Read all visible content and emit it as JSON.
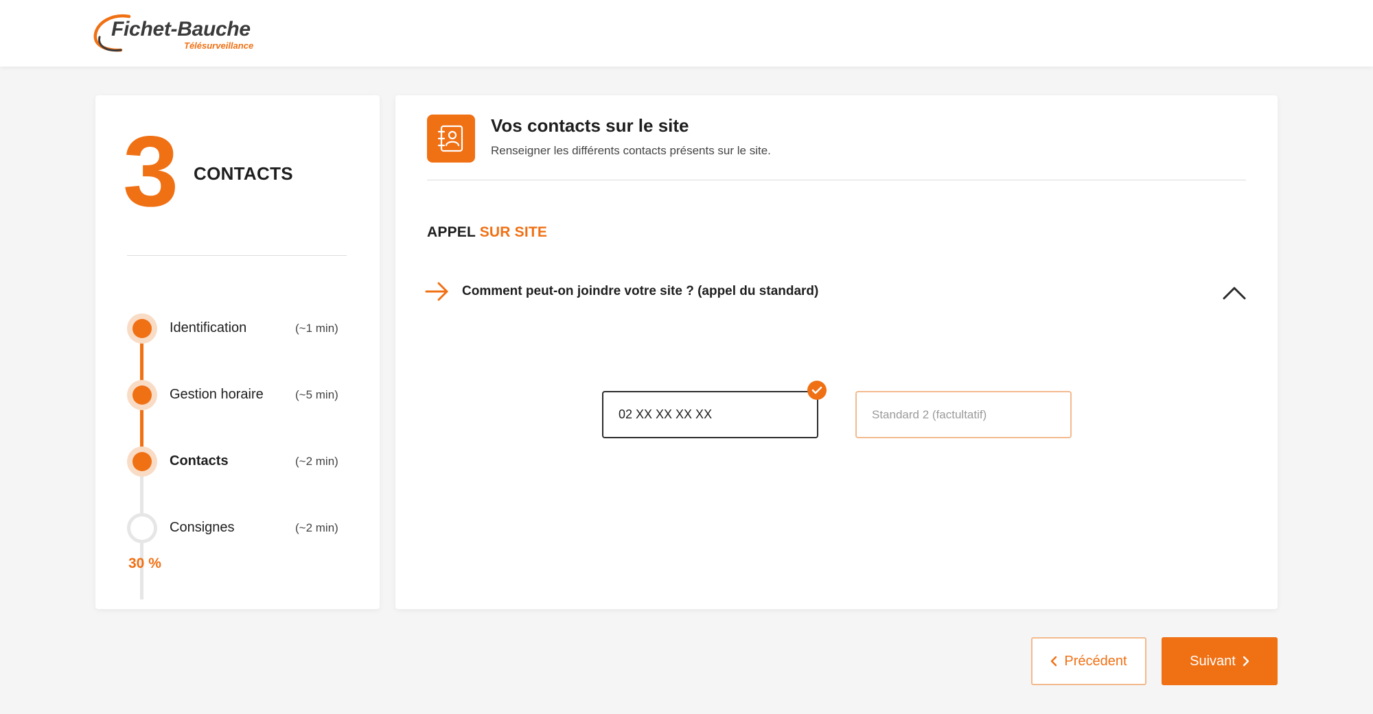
{
  "brand": {
    "name": "Fichet-Bauche",
    "tagline": "Télésurveillance",
    "accent_color": "#f07014"
  },
  "sidebar": {
    "step_number": "3",
    "step_title": "CONTACTS",
    "steps": [
      {
        "label": "Identification",
        "duration": "(~1 min)",
        "state": "done"
      },
      {
        "label": "Gestion horaire",
        "duration": "(~5 min)",
        "state": "done"
      },
      {
        "label": "Contacts",
        "duration": "(~2 min)",
        "state": "current"
      },
      {
        "label": "Consignes",
        "duration": "(~2 min)",
        "state": "todo"
      }
    ],
    "progress_text": "30 %",
    "progress_value": 0.3
  },
  "section": {
    "icon": "contact-book-icon",
    "title": "Vos contacts sur le site",
    "subtitle": "Renseigner les différents contacts présents sur le site."
  },
  "call": {
    "heading_dark": "APPEL",
    "heading_accent": "SUR SITE",
    "question": "Comment peut-on joindre votre site ? (appel du standard)",
    "toggle_icon": "chevron-up-icon",
    "standard1_value": "02 XX XX XX XX",
    "standard1_valid": true,
    "standard2_placeholder": "Standard 2 (factultatif)",
    "standard2_value": ""
  },
  "nav": {
    "prev_label": "Précédent",
    "next_label": "Suivant"
  }
}
